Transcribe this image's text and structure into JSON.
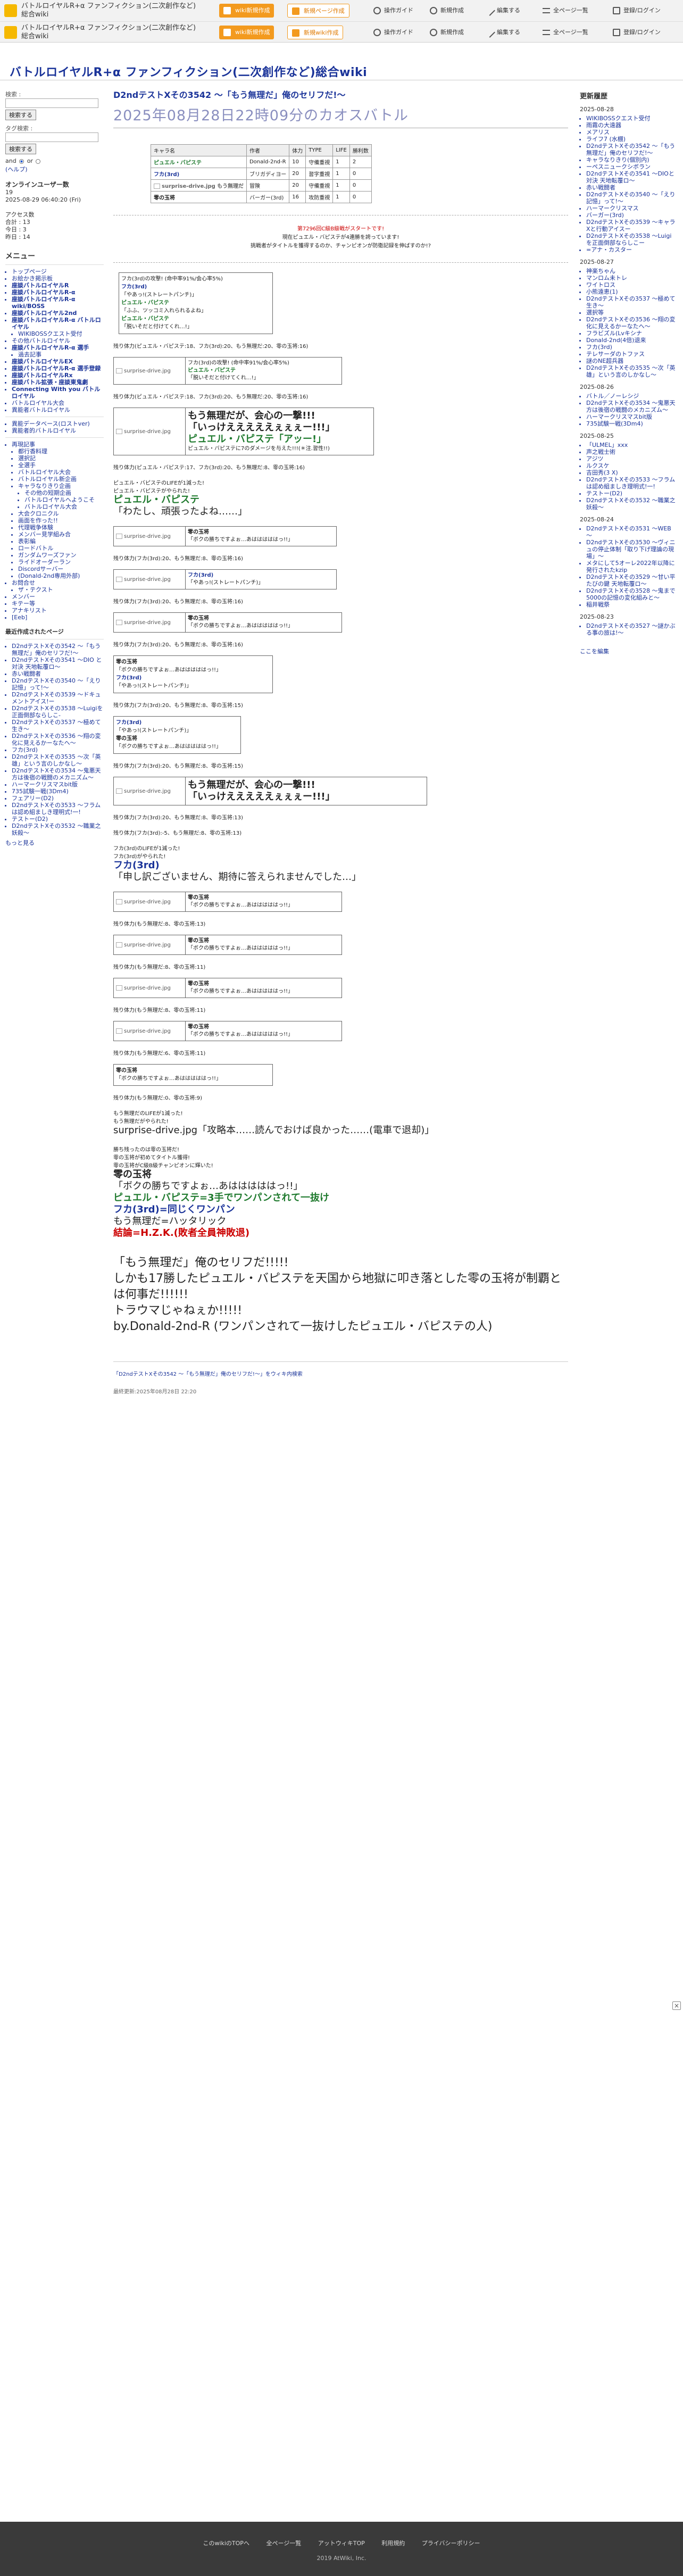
{
  "topbar": {
    "site_name": "バトルロイヤルR+α ファンフィクション(二次創作など)総合wiki",
    "btn_wiki_new": "wiki新規作成",
    "btn_new_page": "新規ページ作成",
    "btn_new_wiki": "新規wiki作成",
    "links": [
      "操作ガイド",
      "新規作成",
      "編集する",
      "全ページ一覧",
      "登録/ログイン"
    ],
    "logo_icon": "atwiki-logo-icon"
  },
  "wiki_title": "バトルロイヤルR+α ファンフィクション(二次創作など)総合wiki",
  "left": {
    "search_label": "検索 :",
    "search_button": "検索する",
    "tag_label": "タグ検索 :",
    "tag_button": "検索する",
    "and_label": "and",
    "or_label": "or",
    "search_help": "(ヘルプ)",
    "online_title": "オンラインユーザー数",
    "online_count": "19",
    "online_time": "2025-08-29 06:40:20 (Fri)",
    "access_title": "アクセス数",
    "access_total": "合計 : 13",
    "access_today": "今日 : 3",
    "access_yesterday": "昨日 : 14",
    "menu_title": "メニュー",
    "menu_items": [
      {
        "label": "トップページ",
        "cls": ""
      },
      {
        "label": "お絵かき掲示板",
        "cls": ""
      },
      {
        "label": "座談バトルロイヤルR",
        "cls": "bold"
      },
      {
        "label": "座談バトルロイヤルR-α",
        "cls": "bold"
      },
      {
        "label": "座談バトルロイヤルR-α wiki/BOSS",
        "cls": "bold"
      },
      {
        "label": "座談バトルロイヤル2nd",
        "cls": "bold"
      },
      {
        "label": "座談バトルロイヤルR-α バトルロイヤル",
        "cls": "bold"
      },
      {
        "label": "WIKIBOSSクエスト受付",
        "cls": "sub"
      },
      {
        "label": "その他バトルロイヤル",
        "cls": ""
      },
      {
        "label": "座談バトルロイヤルR-α 選手",
        "cls": "bold"
      },
      {
        "label": "過去記事",
        "cls": "sub"
      },
      {
        "label": "座談バトルロイヤルEX",
        "cls": "bold"
      },
      {
        "label": "座談バトルロイヤルR-α 選手登録",
        "cls": "bold"
      },
      {
        "label": "座談バトルロイヤルRx",
        "cls": "bold"
      },
      {
        "label": "座談バトル拡張・座談東鬼劇",
        "cls": "bold"
      },
      {
        "label": "Connecting With you バトルロイヤル",
        "cls": "bold"
      },
      {
        "label": "バトルロイヤル大会",
        "cls": ""
      },
      {
        "label": "異能者バトルロイヤル",
        "cls": ""
      }
    ],
    "menu2_items": [
      {
        "label": "異能データベース(ロストver)",
        "cls": ""
      },
      {
        "label": "異能者的バトルロイヤル",
        "cls": ""
      }
    ],
    "menu3_items": [
      {
        "label": "再現記事",
        "cls": ""
      },
      {
        "label": "都行香料理",
        "cls": "sub"
      },
      {
        "label": "選択記",
        "cls": "sub"
      },
      {
        "label": "全選手",
        "cls": "sub"
      },
      {
        "label": "バトルロイヤル大会",
        "cls": "sub"
      },
      {
        "label": "バトルロイヤル新企画",
        "cls": "sub"
      },
      {
        "label": "キャラなりきり企画",
        "cls": "sub"
      },
      {
        "label": "その他の短期企画",
        "cls": "sub2"
      },
      {
        "label": "バトルロイヤルへようこそ",
        "cls": "sub2"
      },
      {
        "label": "バトルロイヤル大会",
        "cls": "sub2"
      },
      {
        "label": "大会クロニクル",
        "cls": "sub"
      },
      {
        "label": "画面を作った!!",
        "cls": "sub"
      },
      {
        "label": "代理戦争体験",
        "cls": "sub"
      },
      {
        "label": "メンバー見学組み合",
        "cls": "sub"
      },
      {
        "label": "表彰編",
        "cls": "sub"
      },
      {
        "label": "ロードバトル",
        "cls": "sub"
      },
      {
        "label": "ガンダムワーズファン",
        "cls": "sub"
      },
      {
        "label": "ライドオーダーラン",
        "cls": "sub"
      },
      {
        "label": "Discordサーバー",
        "cls": "sub"
      },
      {
        "label": "(Donald-2nd専用外部)",
        "cls": "sub"
      },
      {
        "label": "お問合せ",
        "cls": ""
      },
      {
        "label": "ザ・テクスト",
        "cls": "sub"
      },
      {
        "label": "メンバー",
        "cls": ""
      },
      {
        "label": "キテー等",
        "cls": ""
      },
      {
        "label": "アナキリスト",
        "cls": ""
      },
      {
        "label": "[Eeb]",
        "cls": ""
      }
    ],
    "recent_title": "最近作成されたページ",
    "recent_items": [
      "D2ndテストXその3542 ～「もう無理だ」俺のセリフだ!～",
      "D2ndテストXその3541 ～DIO と対決 天地転覆ロ～",
      "赤い戦闘者",
      "D2ndテストXその3540 ～「えり記憶」って!～",
      "D2ndテストXその3539 ～ドキュメントアイス!ー",
      "D2ndテストXその3538 ～Luigiを正面倒部ならしこ-",
      "D2ndテストXその3537 ～極めて生き～",
      "D2ndテストXその3536 ～翔の変化に見えるかーなたへ～",
      "フカ(3rd)",
      "D2ndテストXその3535 ～次「英雄」という言のしかなし～",
      "D2ndテストXその3534 ～鬼悪天方は後宿の戦闘のメカニズム～",
      "ハーマークリスマスbit版",
      "735試験一戦(3Dm4)",
      "フェアリー(D2)",
      "D2ndテストXその3533 ～フラムは認め組ましき理明式!一!",
      "テストー(D2)",
      "D2ndテストXその3532 ～職業之妖殺～"
    ],
    "more_link": "もっと見る"
  },
  "right": {
    "title": "更新履歴",
    "groups": [
      {
        "date": "2025-08-28",
        "items": [
          "WIKIBOSSクエスト受付",
          "雨霧の大遠器",
          "メアリス",
          "ライフ7 (水棚)",
          "D2ndテストXその3542 ～「もう無理だ」俺のセリフだ!～",
          "キャラなりきり(個別内)",
          "ーペスニュークシボラン",
          "D2ndテストXその3541 ～DIOと対決 天地転覆ロ～",
          "赤い戦闘者",
          "D2ndテストXその3540 ～「えり記憶」って!～",
          "ハーマークリスマス",
          "バーガー(3rd)",
          "D2ndテストXその3539 ～キャラXと行動アイスー",
          "D2ndテストXその3538 ～Luigiを正面倒部ならしこー",
          "=アナ・カスター"
        ]
      },
      {
        "date": "2025-08-27",
        "items": [
          "神楽ちゃん",
          "マンロム未トレ",
          "ワイトロス",
          "小熊遠恵(1)",
          "D2ndテストXその3537 ～極めて生き～",
          "選択等",
          "D2ndテストXその3536 ～翔の変化に見えるかーなたへ～",
          "フラビズル(Lvキシナ",
          "Donald-2nd(4倍)退来",
          "フカ(3rd)",
          "テレサーダのトファス",
          "謎のNE超兵器",
          "D2ndテストXその3535 ～次「英雄」という言のしかなし～"
        ]
      },
      {
        "date": "2025-08-26",
        "items": [
          "バトル／ノーレシジ",
          "D2ndテストXその3534 ～鬼悪天方は後宿の戦闘のメカニズム～",
          "ハーマークリスマスbit版",
          "735試験一戦(3Dm4)"
        ]
      },
      {
        "date": "2025-08-25",
        "items": [
          "「ULMEL」xxx",
          "声之戦士術",
          "アジツ",
          "ルクスケ",
          "吉田秀(3 X)",
          "D2ndテストXその3533 ～フラムは認め組ましき理明式!一!",
          "テストー(D2)",
          "D2ndテストXその3532 ～職業之妖殺～"
        ]
      },
      {
        "date": "2025-08-24",
        "items": [
          "D2ndテストXその3531 ～WEB～",
          "D2ndテストXその3530 ～ヴィニュの停止体制「取り下げ理論の現場」～",
          "メタにして5オーレ2022年以降に発行されたkzip",
          "D2ndテストXその3529 ～甘い平たびの鍵 天地転覆ロ～",
          "D2ndテストXその3528 ～鬼まで5000の記憶の変化組みと～",
          "稲井戦祭"
        ]
      },
      {
        "date": "2025-08-23",
        "items": [
          "D2ndテストXその3527 ～謎かぶる事の旅は!～"
        ]
      }
    ],
    "edit_link": "ここを編集"
  },
  "main": {
    "title": "D2ndテストXその3542 ～「もう無理だ」俺のセリフだ!～",
    "subtitle": "2025年08月28日22時09分のカオスバトル",
    "table_headers": [
      "キャラ名",
      "作者",
      "体力",
      "TYPE",
      "LIFE",
      "勝利数"
    ],
    "table_rows": [
      [
        "ピュエル・バピステ",
        "Donald-2nd-R",
        "10",
        "守備重視",
        "1",
        "2"
      ],
      [
        "フカ(3rd)",
        "ブリガディヨー",
        "20",
        "習字重視",
        "1",
        "0"
      ],
      [
        "surprise-drive.jpg もう無理だ",
        "冒険",
        "20",
        "守備重視",
        "1",
        "0"
      ],
      [
        "零の玉将",
        "バーガー(3rd)",
        "16",
        "攻防重視",
        "1",
        "0"
      ]
    ],
    "intro_1": "第7296回C級B級戦がスタートです!",
    "intro_2": "現在ピュエル・バピステが4連勝を誇っています!",
    "intro_3": "挑戦者がタイトルを獲得するのか、チャンピオンが防衛記録を伸ばすのか!?",
    "fuka_attack_1": "フカ(3rd)の攻撃! (命中率91%/会心率5%)",
    "fuka_name": "フカ(3rd)",
    "fuka_line_1": "「やあっ!(ストレートパンチ)」",
    "pyu_name": "ピュエル・バピステ",
    "pyu_reply_1": "「ふふ、ツッコミ入れられるよね」",
    "pyu_reply_2": "「脱いそだと付けてくれ…!」",
    "hp1": "残り体力(ピュエル・バピステ:18、フカ(3rd):20、もう無理だ:20、零の玉将:16)",
    "hp2": "残り体力(ピュエル・バピステ:18、フカ(3rd):20、もう無理だ:20、零の玉将:16)",
    "hp3": "残り体力(ピュエル・バピステ:17、フカ(3rd):20、もう無理だ:8、零の玉将:16)",
    "nope_big_1": "もう無理だが、会心の一撃!!!",
    "nope_big_2": "「いっけえええええぇぇぇー!!!」",
    "pyu_big": "ピュエル・バピステ「アッー!」",
    "pyu_dmg": "ピュエル・バピステに7のダメージを与えた!!!(＊注.習性!!)",
    "pyu_faint_1": "ピュエル・バピステのLIFEが1減った!",
    "pyu_faint_2": "ピュエル・バピステがやられた!",
    "pyu_last_name": "ピュエル・バピステ",
    "pyu_last_line": "「わたし、頑張ったよね……」",
    "hp_lines": [
      "残り体力(フカ(3rd):20、もう無理だ:8、零の玉将:16)",
      "残り体力(フカ(3rd):20、もう無理だ:8、零の玉将:16)",
      "残り体力(フカ(3rd):20、もう無理だ:8、零の玉将:16)",
      "残り体力(フカ(3rd):20、もう無理だ:8、零の玉将:15)",
      "残り体力(フカ(3rd):20、もう無理だ:8、零の玉将:15)",
      "残り体力(フカ(3rd):20、もう無理だ:8、零の玉将:13)",
      "残り体力(フカ(3rd):-5、もう無理だ:8、零の玉将:13)"
    ],
    "fuka_faint_1": "フカ(3rd)のLIFEが1減った!",
    "fuka_faint_2": "フカ(3rd)がやられた!",
    "fuka_last_name": "フカ(3rd)",
    "fuka_last_line": "「申し訳ございません、期待に答えられませんでした…」",
    "hp_final_lines": [
      "残り体力(もう無理だ:8、零の玉将:13)",
      "残り体力(もう無理だ:8、零の玉将:11)",
      "残り体力(もう無理だ:8、零の玉将:11)",
      "残り体力(もう無理だ:6、零の玉将:11)",
      "残り体力(もう無理だ:0、零の玉将:9)"
    ],
    "nope_faint_1": "もう無理だのLIFEが1減った!",
    "nope_faint_2": "もう無理だがやられた!",
    "nope_last": "surprise-drive.jpg「攻略本……読んでおけば良かった……(電車で退却)」",
    "winner_1": "勝ち残ったのは零の玉将だ!",
    "winner_2": "零の玉将が初めてタイトル獲得!",
    "winner_3": "零の玉将がC級B級チャンピオンに輝いた!",
    "winner_name": "零の玉将",
    "winner_line": "「ボクの勝ちですよぉ…あはははははっ!!」",
    "result_1": "ピュエル・バピステ=3手でワンパンされて一抜け",
    "result_2": "フカ(3rd)=同じくワンパン",
    "result_3": "もう無理だ=ハッタリック",
    "result_4": "結論=H.Z.K.(敗者全員神敗退)",
    "closing_1": "「もう無理だ」俺のセリフだ!!!!!",
    "closing_2": "しかも17勝したピュエル・バピステを天国から地獄に叩き落とした零の玉将が制覇とは何事だ!!!!!!",
    "closing_3": "トラウマじゃねぇか!!!!!",
    "closing_4": "by.Donald-2nd-R (ワンパンされて一抜けしたピュエル・バピステの人)",
    "footer_nav": "「D2ndテストXその3542 ～「もう無理だ」俺のセリフだ!～」をウィキ内検索",
    "footer_updated": "最終更新:2025年08月28日 22:20"
  },
  "site_footer": {
    "links": [
      "このwikiのTOPへ",
      "全ページ一覧",
      "アットウィキTOP",
      "利用規約",
      "プライバシーポリシー"
    ],
    "copyright": "2019 AtWiki, Inc."
  }
}
